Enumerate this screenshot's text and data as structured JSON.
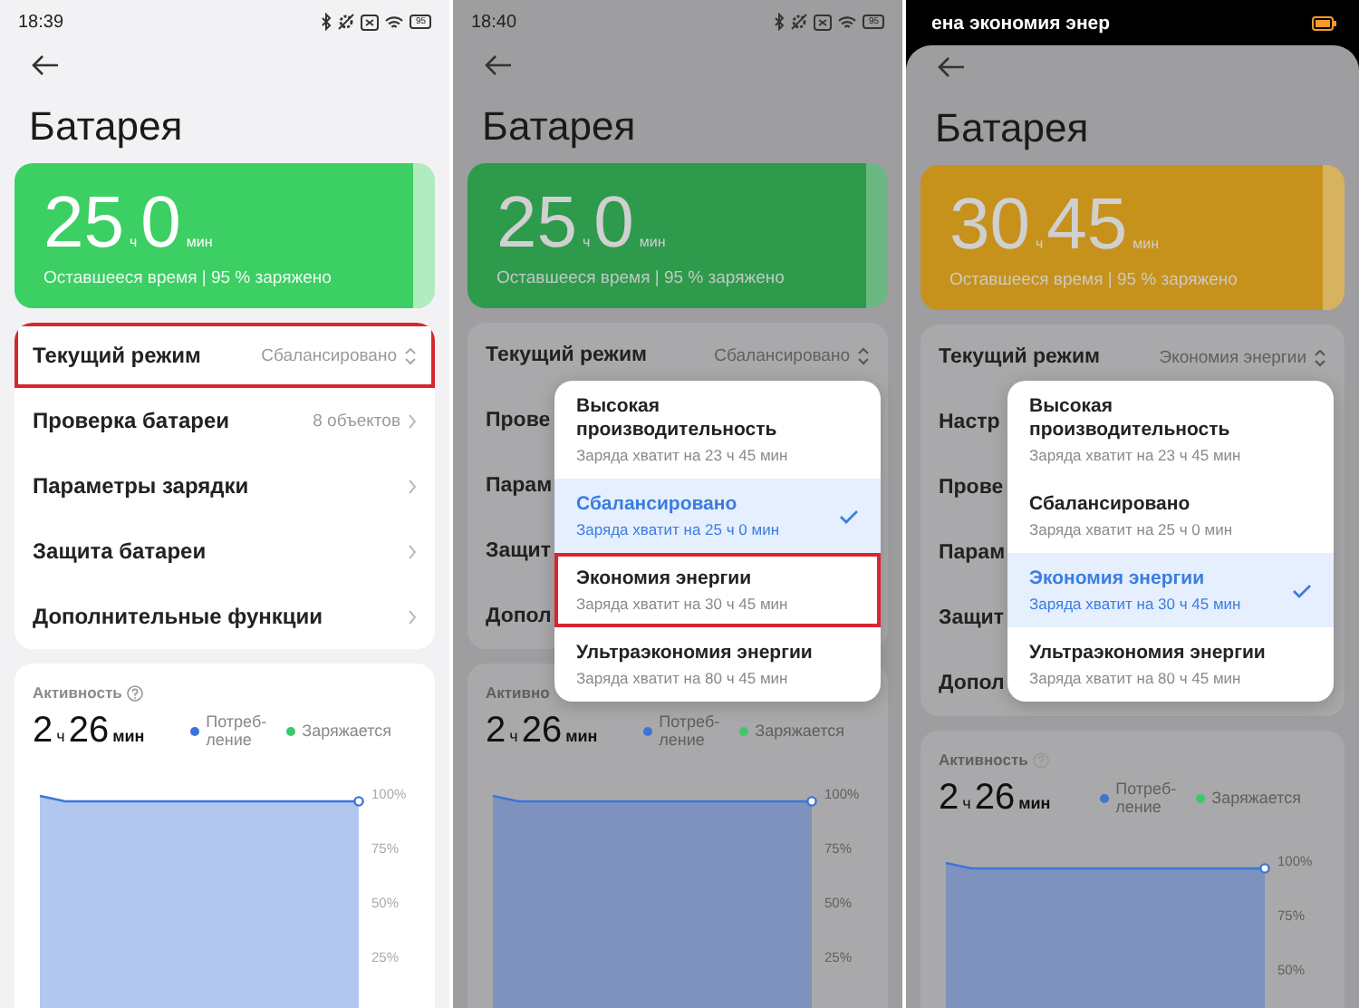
{
  "phones": [
    {
      "status_bar": {
        "kind": "icons",
        "time": "18:39",
        "battery": "95"
      },
      "dimmed": false,
      "title": "Батарея",
      "battery_card": {
        "hours": "25",
        "hours_unit": "ч",
        "minutes": "0",
        "minutes_unit": "мин",
        "caption": "Оставшееся время | 95 % заряжено",
        "color": "#3ccf63"
      },
      "settings": [
        {
          "label": "Текущий режим",
          "value": "Сбалансировано",
          "kind": "dropdown",
          "highlighted": true
        },
        {
          "label": "Проверка батареи",
          "value": "8 объектов",
          "kind": "link",
          "highlighted": false
        },
        {
          "label": "Параметры зарядки",
          "kind": "link",
          "highlighted": false
        },
        {
          "label": "Защита батареи",
          "kind": "link",
          "highlighted": false
        },
        {
          "label": "Дополнительные функции",
          "kind": "link",
          "highlighted": false
        }
      ],
      "activity": {
        "title": "Активность",
        "help_icon": true,
        "hours": "2",
        "hours_unit": "ч",
        "minutes": "26",
        "minutes_unit": "мин",
        "legend": [
          {
            "label": "Потреб-ление",
            "color": "#3d74d9"
          },
          {
            "label": "Заряжается",
            "color": "#3cc86a"
          }
        ],
        "axis_labels": [
          "100%",
          "75%",
          "50%",
          "25%"
        ]
      }
    },
    {
      "status_bar": {
        "kind": "icons",
        "time": "18:40",
        "battery": "95"
      },
      "dimmed": true,
      "title": "Батарея",
      "battery_card": {
        "hours": "25",
        "hours_unit": "ч",
        "minutes": "0",
        "minutes_unit": "мин",
        "caption": "Оставшееся время | 95 % заряжено",
        "color": "#2e9a4c"
      },
      "settings": [
        {
          "label": "Текущий режим",
          "value": "Сбалансировано",
          "kind": "dropdown",
          "highlighted": false
        },
        {
          "label": "Прове",
          "kind": "plain",
          "highlighted": false
        },
        {
          "label": "Парам",
          "kind": "plain",
          "highlighted": false
        },
        {
          "label": "Защит",
          "kind": "plain",
          "highlighted": false
        },
        {
          "label": "Допол",
          "kind": "plain",
          "highlighted": false
        }
      ],
      "activity": {
        "title": "Активно",
        "help_icon": false,
        "hours": "2",
        "hours_unit": "ч",
        "minutes": "26",
        "minutes_unit": "мин",
        "legend": [
          {
            "label": "Потреб-ление",
            "color": "#3d74d9"
          },
          {
            "label": "Заряжается",
            "color": "#3cc86a"
          }
        ],
        "axis_labels": [
          "100%",
          "75%",
          "50%",
          "25%"
        ]
      },
      "popup": {
        "options": [
          {
            "title": "Высокая производительность",
            "subtitle": "Заряда хватит на 23 ч 45 мин",
            "selected": false,
            "highlighted": false
          },
          {
            "title": "Сбалансировано",
            "subtitle": "Заряда хватит на 25 ч 0 мин",
            "selected": true,
            "highlighted": false
          },
          {
            "title": "Экономия энергии",
            "subtitle": "Заряда хватит на 30 ч 45 мин",
            "selected": false,
            "highlighted": true
          },
          {
            "title": "Ультраэкономия энергии",
            "subtitle": "Заряда хватит на 80 ч 45 мин",
            "selected": false,
            "highlighted": false
          }
        ]
      }
    },
    {
      "status_bar": {
        "kind": "notice",
        "text": "ена экономия энер"
      },
      "dimmed": true,
      "title": "Батарея",
      "battery_card": {
        "hours": "30",
        "hours_unit": "ч",
        "minutes": "45",
        "minutes_unit": "мин",
        "caption": "Оставшееся время | 95 % заряжено",
        "color": "#c6921c"
      },
      "settings": [
        {
          "label": "Текущий режим",
          "value": "Экономия энергии",
          "kind": "dropdown",
          "highlighted": false
        },
        {
          "label": "Настр",
          "kind": "plain",
          "highlighted": false
        },
        {
          "label": "Прове",
          "kind": "plain",
          "highlighted": false
        },
        {
          "label": "Парам",
          "kind": "plain",
          "highlighted": false
        },
        {
          "label": "Защит",
          "kind": "plain",
          "highlighted": false
        },
        {
          "label": "Допол",
          "kind": "plain",
          "highlighted": false
        }
      ],
      "activity": {
        "title": "Активность",
        "help_icon": true,
        "hours": "2",
        "hours_unit": "ч",
        "minutes": "26",
        "minutes_unit": "мин",
        "legend": [
          {
            "label": "Потреб-ление",
            "color": "#3d74d9"
          },
          {
            "label": "Заряжается",
            "color": "#3cc86a"
          }
        ],
        "axis_labels": [
          "100%",
          "75%",
          "50%"
        ]
      },
      "popup": {
        "options": [
          {
            "title": "Высокая производительность",
            "subtitle": "Заряда хватит на 23 ч 45 мин",
            "selected": false,
            "highlighted": false
          },
          {
            "title": "Сбалансировано",
            "subtitle": "Заряда хватит на 25 ч 0 мин",
            "selected": false,
            "highlighted": false
          },
          {
            "title": "Экономия энергии",
            "subtitle": "Заряда хватит на 30 ч 45 мин",
            "selected": true,
            "highlighted": false
          },
          {
            "title": "Ультраэкономия энергии",
            "subtitle": "Заряда хватит на 80 ч 45 мин",
            "selected": false,
            "highlighted": false
          }
        ]
      }
    }
  ]
}
